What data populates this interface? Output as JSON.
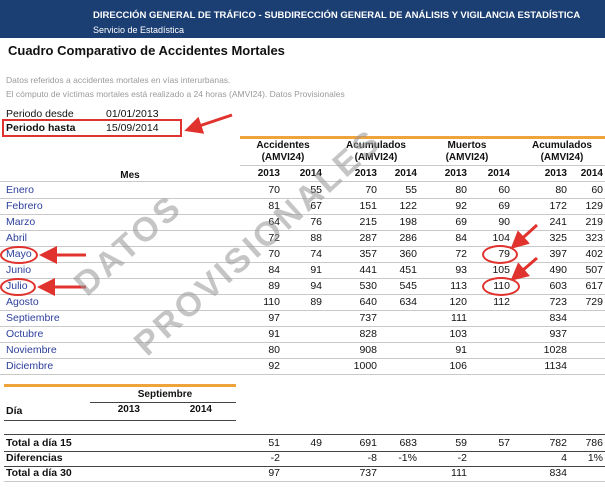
{
  "header": {
    "line1": "DIRECCIÓN GENERAL DE TRÁFICO - SUBDIRECCIÓN GENERAL DE ANÁLISIS Y VIGILANCIA ESTADÍSTICA",
    "line2": "Servicio de Estadística"
  },
  "title": "Cuadro Comparativo de Accidentes Mortales",
  "notes": [
    "Datos referidos a accidentes mortales en vías interurbanas.",
    "El cómputo de víctimas mortales está realizado a 24 horas (AMVI24). Datos Provisionales"
  ],
  "period": {
    "desde_label": "Periodo desde",
    "desde_value": "01/01/2013",
    "hasta_label": "Periodo hasta",
    "hasta_value": "15/09/2014"
  },
  "table": {
    "mes_label": "Mes",
    "groups": [
      {
        "line1": "Accidentes",
        "line2": "(AMVI24)"
      },
      {
        "line1": "Acumulados",
        "line2": "(AMVI24)"
      },
      {
        "line1": "Muertos",
        "line2": "(AMVI24)"
      },
      {
        "line1": "Acumulados",
        "line2": "(AMVI24)"
      }
    ],
    "years": [
      "2013",
      "2014",
      "2013",
      "2014",
      "2013",
      "2014",
      "2013",
      "2014"
    ],
    "rows": [
      {
        "mes": "Enero",
        "v": [
          "70",
          "55",
          "70",
          "55",
          "80",
          "60",
          "80",
          "60"
        ]
      },
      {
        "mes": "Febrero",
        "v": [
          "81",
          "67",
          "151",
          "122",
          "92",
          "69",
          "172",
          "129"
        ]
      },
      {
        "mes": "Marzo",
        "v": [
          "64",
          "76",
          "215",
          "198",
          "69",
          "90",
          "241",
          "219"
        ]
      },
      {
        "mes": "Abril",
        "v": [
          "72",
          "88",
          "287",
          "286",
          "84",
          "104",
          "325",
          "323"
        ]
      },
      {
        "mes": "Mayo",
        "v": [
          "70",
          "74",
          "357",
          "360",
          "72",
          "79",
          "397",
          "402"
        ]
      },
      {
        "mes": "Junio",
        "v": [
          "84",
          "91",
          "441",
          "451",
          "93",
          "105",
          "490",
          "507"
        ]
      },
      {
        "mes": "Julio",
        "v": [
          "89",
          "94",
          "530",
          "545",
          "113",
          "110",
          "603",
          "617"
        ]
      },
      {
        "mes": "Agosto",
        "v": [
          "110",
          "89",
          "640",
          "634",
          "120",
          "112",
          "723",
          "729"
        ]
      },
      {
        "mes": "Septiembre",
        "v": [
          "97",
          "",
          "737",
          "",
          "111",
          "",
          "834",
          ""
        ]
      },
      {
        "mes": "Octubre",
        "v": [
          "91",
          "",
          "828",
          "",
          "103",
          "",
          "937",
          ""
        ]
      },
      {
        "mes": "Noviembre",
        "v": [
          "80",
          "",
          "908",
          "",
          "91",
          "",
          "1028",
          ""
        ]
      },
      {
        "mes": "Diciembre",
        "v": [
          "92",
          "",
          "1000",
          "",
          "106",
          "",
          "1134",
          ""
        ]
      }
    ]
  },
  "sept_table": {
    "title": "Septiembre",
    "dia_label": "Día",
    "years": [
      "2013",
      "2014"
    ]
  },
  "bottom": {
    "rows": [
      {
        "label": "Total a día 15",
        "v": [
          "51",
          "49",
          "691",
          "683",
          "59",
          "57",
          "782",
          "786"
        ]
      },
      {
        "label": "Diferencias",
        "v": [
          "-2",
          "",
          "-8",
          "-1%",
          "-2",
          "",
          "4",
          "1%"
        ]
      },
      {
        "label": "Total a día 30",
        "v": [
          "97",
          "",
          "737",
          "",
          "111",
          "",
          "834",
          ""
        ]
      }
    ]
  },
  "watermark": [
    "DATOS",
    "PROVISIONALES"
  ],
  "colors": {
    "header_bg": "#1b3f73",
    "accent": "#f1a33b",
    "highlight": "#e0332e",
    "month_text": "#2c3f9a"
  }
}
